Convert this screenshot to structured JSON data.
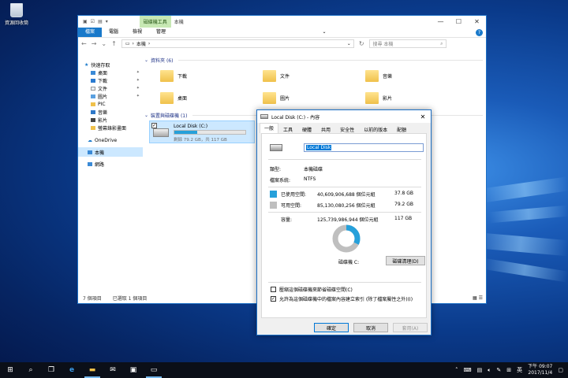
{
  "desktop": {
    "recycle_label": "資源回收筒"
  },
  "explorer": {
    "title": "本機",
    "context_tab": "磁碟機工具",
    "ribbon_tabs": [
      "檔案",
      "電腦",
      "檢視",
      "管理"
    ],
    "address": "本機",
    "search_placeholder": "搜尋 本機",
    "nav": {
      "quick_access": "快速存取",
      "items": [
        "桌面",
        "下載",
        "文件",
        "圖片",
        "PIC",
        "音樂",
        "影片",
        "螢幕錄影畫面"
      ],
      "onedrive": "OneDrive",
      "this_pc": "本機",
      "network": "網路"
    },
    "folders_header": "資料夾 (6)",
    "folders": [
      "下載",
      "文件",
      "音樂",
      "桌面",
      "圖片",
      "影片"
    ],
    "devices_header": "裝置與磁碟機 (1)",
    "drive": {
      "name": "Local Disk (C:)",
      "size_text": "剩餘 79.2 GB，共 117 GB",
      "used_fraction": 0.324
    },
    "status": {
      "count": "7 個項目",
      "selected": "已選取 1 個項目"
    }
  },
  "dialog": {
    "title": "Local Disk (C:) - 內容",
    "tabs": [
      "一般",
      "工具",
      "硬體",
      "共用",
      "安全性",
      "以前的版本",
      "配額"
    ],
    "name_value": "Local Disk",
    "type_label": "類型:",
    "type_value": "本機磁碟",
    "fs_label": "檔案系統:",
    "fs_value": "NTFS",
    "used_label": "已使用空間:",
    "used_bytes": "40,609,906,688 個位元組",
    "used_gb": "37.8 GB",
    "free_label": "可用空間:",
    "free_bytes": "85,130,080,256 個位元組",
    "free_gb": "79.2 GB",
    "cap_label": "容量:",
    "cap_bytes": "125,739,986,944 個位元組",
    "cap_gb": "117 GB",
    "used_fraction": 0.323,
    "drive_label": "磁碟機 C:",
    "cleanup_button": "磁碟清理(D)",
    "compress_label": "壓縮這個磁碟機來節省磁碟空間(C)",
    "index_label": "允許為這個磁碟機中的檔案內容建立索引 (除了檔案屬性之外)(I)",
    "ok": "確定",
    "cancel": "取消",
    "apply": "套用(A)",
    "colors": {
      "used": "#26a0da",
      "free": "#bfbfbf"
    }
  },
  "taskbar": {
    "ime": "英",
    "time": "下午 09:07",
    "date": "2017/11/4"
  }
}
